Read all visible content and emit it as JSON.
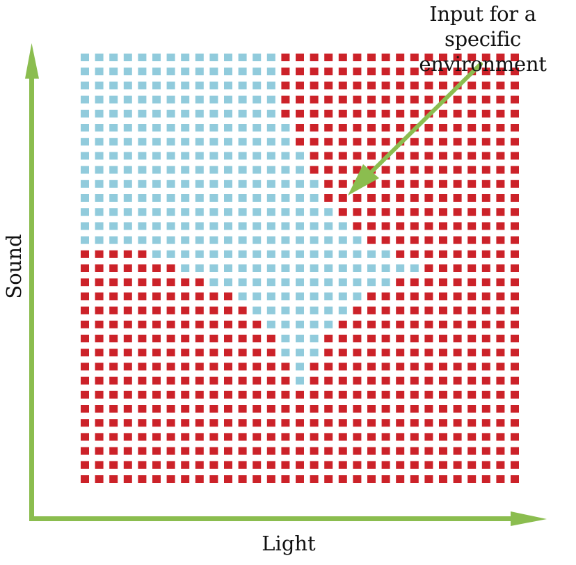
{
  "annotation": {
    "line1": "Input for a specific",
    "line2": "environment"
  },
  "axes": {
    "x_label": "Light",
    "y_label": "Sound"
  },
  "colors": {
    "class_a": "#91cbdc",
    "class_b": "#cc2229",
    "arrow": "#8bbd4f"
  },
  "legend_codes": {
    "B": "class_a",
    "R": "class_b"
  },
  "grid": {
    "rows": 31,
    "cols": 31,
    "cells": [
      "BBBBBBBBBBBBBBRRRRRRRRRRRRRRRRR",
      "BBBBBBBBBBBBBBRRRRRRRRRRRRRRRRR",
      "BBBBBBBBBBBBBBRRRRRRRRRRRRRRRRR",
      "BBBBBBBBBBBBBBRRRRRRRRRRRRRRRRR",
      "BBBBBBBBBBBBBBRRRRRRRRRRRRRRRRR",
      "BBBBBBBBBBBBBBBRRRRRRRRRRRRRRRR",
      "BBBBBBBBBBBBBBBRRRRRRRRRRRRRRRR",
      "BBBBBBBBBBBBBBBBRRRRRRRRRRRRRRR",
      "BBBBBBBBBBBBBBBBRRRRRRRRRRRRRRR",
      "BBBBBBBBBBBBBBBBBRRRRRRRRRRRRRR",
      "BBBBBBBBBBBBBBBBBRRRRRRRRRRRRRR",
      "BBBBBBBBBBBBBBBBBBRRRRRRRRRRRRR",
      "BBBBBBBBBBBBBBBBBBBRRRRRRRRRRRR",
      "BBBBBBBBBBBBBBBBBBBBRRRRRRRRRRR",
      "RRRRRBBBBBBBBBBBBBBBBBRRRRRRRRR",
      "RRRRRRRBBBBBBBBBBBBBBBBBRRRRRRR",
      "RRRRRRRRRBBBBBBBBBBBBBRRRRRRRRR",
      "RRRRRRRRRRRBBBBBBBBBRRRRRRRRRRR",
      "RRRRRRRRRRRRBBBBBBBRRRRRRRRRRRR",
      "RRRRRRRRRRRRRBBBBBRRRRRRRRRRRRR",
      "RRRRRRRRRRRRRRBBBRRRRRRRRRRRRRR",
      "RRRRRRRRRRRRRRBBBRRRRRRRRRRRRRR",
      "RRRRRRRRRRRRRRRBRRRRRRRRRRRRRRR",
      "RRRRRRRRRRRRRRRBRRRRRRRRRRRRRRR",
      "RRRRRRRRRRRRRRRRRRRRRRRRRRRRRRR",
      "RRRRRRRRRRRRRRRRRRRRRRRRRRRRRRR",
      "RRRRRRRRRRRRRRRRRRRRRRRRRRRRRRR",
      "RRRRRRRRRRRRRRRRRRRRRRRRRRRRRRR",
      "RRRRRRRRRRRRRRRRRRRRRRRRRRRRRRR",
      "RRRRRRRRRRRRRRRRRRRRRRRRRRRRRRR",
      "RRRRRRRRRRRRRRRRRRRRRRRRRRRRRRR"
    ],
    "highlighted_cell": {
      "row": 9,
      "col": 18
    }
  }
}
